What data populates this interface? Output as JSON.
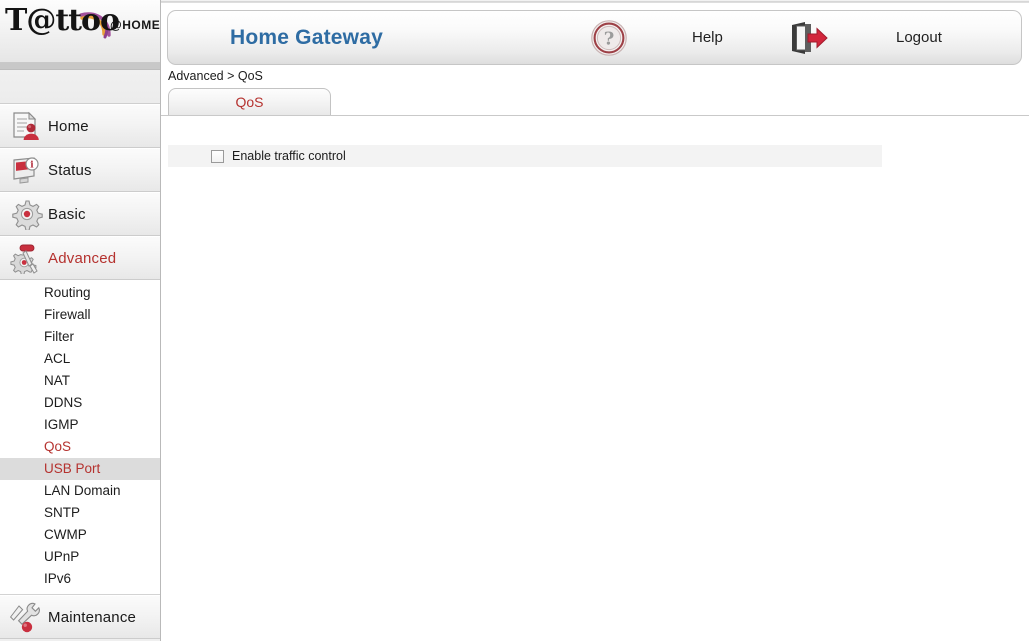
{
  "brand": {
    "wordmark": "T@ttoo",
    "suffix": "@HOME"
  },
  "header": {
    "title": "Home Gateway",
    "help_label": "Help",
    "help_icon": "question-circle-icon",
    "logout_label": "Logout",
    "logout_icon": "door-exit-arrow-icon",
    "title_color": "#2e6ca3"
  },
  "breadcrumb": {
    "text": "Advanced > QoS"
  },
  "tabs": [
    {
      "label": "QoS",
      "active": true
    }
  ],
  "sidebar": {
    "items": [
      {
        "label": "Home",
        "icon": "document-user-icon",
        "active": false
      },
      {
        "label": "Status",
        "icon": "monitor-info-icon",
        "active": false
      },
      {
        "label": "Basic",
        "icon": "gear-icon",
        "active": false
      },
      {
        "label": "Advanced",
        "icon": "gear-wrench-icon",
        "active": true
      },
      {
        "label": "Maintenance",
        "icon": "wrench-screwdriver-icon",
        "active": false
      }
    ],
    "subitems": [
      {
        "label": "Routing",
        "state": "normal"
      },
      {
        "label": "Firewall",
        "state": "normal"
      },
      {
        "label": "Filter",
        "state": "normal"
      },
      {
        "label": "ACL",
        "state": "normal"
      },
      {
        "label": "NAT",
        "state": "normal"
      },
      {
        "label": "DDNS",
        "state": "normal"
      },
      {
        "label": "IGMP",
        "state": "normal"
      },
      {
        "label": "QoS",
        "state": "current"
      },
      {
        "label": "USB Port",
        "state": "hovered"
      },
      {
        "label": "LAN Domain",
        "state": "normal"
      },
      {
        "label": "SNTP",
        "state": "normal"
      },
      {
        "label": "CWMP",
        "state": "normal"
      },
      {
        "label": "UPnP",
        "state": "normal"
      },
      {
        "label": "IPv6",
        "state": "normal"
      }
    ],
    "active_color": "#b5322f"
  },
  "content": {
    "enable_traffic_control_label": "Enable traffic control",
    "enable_traffic_control_checked": false
  }
}
